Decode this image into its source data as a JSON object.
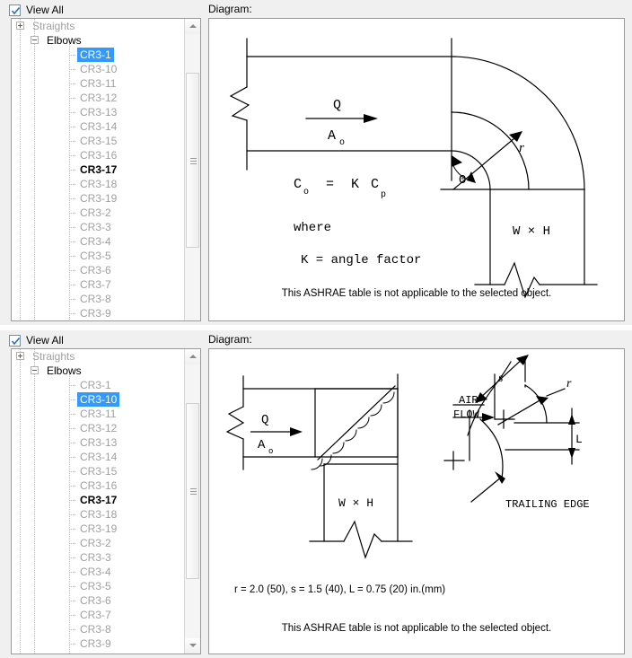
{
  "panels": [
    {
      "view_all_label": "View All",
      "view_all_checked": true,
      "diagram_label": "Diagram:",
      "tree": {
        "items": [
          {
            "label": "Straights",
            "level": 1,
            "expander": "plus",
            "state": "dim"
          },
          {
            "label": "Elbows",
            "level": 2,
            "expander": "minus",
            "state": "root"
          },
          {
            "label": "CR3-1",
            "level": 3,
            "state": "selected"
          },
          {
            "label": "CR3-10",
            "level": 3,
            "state": "dim"
          },
          {
            "label": "CR3-11",
            "level": 3,
            "state": "dim"
          },
          {
            "label": "CR3-12",
            "level": 3,
            "state": "dim"
          },
          {
            "label": "CR3-13",
            "level": 3,
            "state": "dim"
          },
          {
            "label": "CR3-14",
            "level": 3,
            "state": "dim"
          },
          {
            "label": "CR3-15",
            "level": 3,
            "state": "dim"
          },
          {
            "label": "CR3-16",
            "level": 3,
            "state": "dim"
          },
          {
            "label": "CR3-17",
            "level": 3,
            "state": "bold"
          },
          {
            "label": "CR3-18",
            "level": 3,
            "state": "dim"
          },
          {
            "label": "CR3-19",
            "level": 3,
            "state": "dim"
          },
          {
            "label": "CR3-2",
            "level": 3,
            "state": "dim"
          },
          {
            "label": "CR3-3",
            "level": 3,
            "state": "dim"
          },
          {
            "label": "CR3-4",
            "level": 3,
            "state": "dim"
          },
          {
            "label": "CR3-5",
            "level": 3,
            "state": "dim"
          },
          {
            "label": "CR3-6",
            "level": 3,
            "state": "dim"
          },
          {
            "label": "CR3-7",
            "level": 3,
            "state": "dim"
          },
          {
            "label": "CR3-8",
            "level": 3,
            "state": "dim"
          },
          {
            "label": "CR3-9",
            "level": 3,
            "state": "dim"
          }
        ]
      },
      "diagram": {
        "type": "round-elbow",
        "labels": {
          "flow_q": "Q",
          "flow_area": "A",
          "flow_area_sub": "o",
          "theta": "Θ",
          "radius": "r",
          "section": "W × H",
          "formula_c": "C",
          "formula_c_sub": "o",
          "formula_eq": "=",
          "formula_k": "K",
          "formula_cp": "C",
          "formula_cp_sub": "p",
          "where": "where",
          "k_def": "K  =  angle factor"
        },
        "note": "This ASHRAE table is not applicable to the selected object."
      }
    },
    {
      "view_all_label": "View All",
      "view_all_checked": true,
      "diagram_label": "Diagram:",
      "tree": {
        "items": [
          {
            "label": "Straights",
            "level": 1,
            "expander": "plus",
            "state": "dim"
          },
          {
            "label": "Elbows",
            "level": 2,
            "expander": "minus",
            "state": "root"
          },
          {
            "label": "CR3-1",
            "level": 3,
            "state": "dim"
          },
          {
            "label": "CR3-10",
            "level": 3,
            "state": "selected"
          },
          {
            "label": "CR3-11",
            "level": 3,
            "state": "dim"
          },
          {
            "label": "CR3-12",
            "level": 3,
            "state": "dim"
          },
          {
            "label": "CR3-13",
            "level": 3,
            "state": "dim"
          },
          {
            "label": "CR3-14",
            "level": 3,
            "state": "dim"
          },
          {
            "label": "CR3-15",
            "level": 3,
            "state": "dim"
          },
          {
            "label": "CR3-16",
            "level": 3,
            "state": "dim"
          },
          {
            "label": "CR3-17",
            "level": 3,
            "state": "bold"
          },
          {
            "label": "CR3-18",
            "level": 3,
            "state": "dim"
          },
          {
            "label": "CR3-19",
            "level": 3,
            "state": "dim"
          },
          {
            "label": "CR3-2",
            "level": 3,
            "state": "dim"
          },
          {
            "label": "CR3-3",
            "level": 3,
            "state": "dim"
          },
          {
            "label": "CR3-4",
            "level": 3,
            "state": "dim"
          },
          {
            "label": "CR3-5",
            "level": 3,
            "state": "dim"
          },
          {
            "label": "CR3-6",
            "level": 3,
            "state": "dim"
          },
          {
            "label": "CR3-7",
            "level": 3,
            "state": "dim"
          },
          {
            "label": "CR3-8",
            "level": 3,
            "state": "dim"
          },
          {
            "label": "CR3-9",
            "level": 3,
            "state": "dim"
          }
        ]
      },
      "diagram": {
        "type": "mitered-elbow-with-vanes",
        "labels": {
          "flow_q": "Q",
          "flow_area": "A",
          "flow_area_sub": "o",
          "section": "W × H",
          "air_flow_line1": "AIR",
          "air_flow_line2": "FLOW",
          "vane_spacing": "s",
          "vane_radius": "r",
          "vane_l": "L",
          "trailing_edge": "TRAILING  EDGE"
        },
        "dimensions_text": "r  =  2.0  (50),   s  =  1.5  (40),   L  =  0.75  (20)  in.(mm)",
        "note": "This ASHRAE table is not applicable to the selected object."
      }
    }
  ],
  "colors": {
    "selection": "#3399ff",
    "dim_text": "#a0a0a0",
    "panel_bg": "#f0f0f0",
    "border": "#9a9a9a"
  }
}
